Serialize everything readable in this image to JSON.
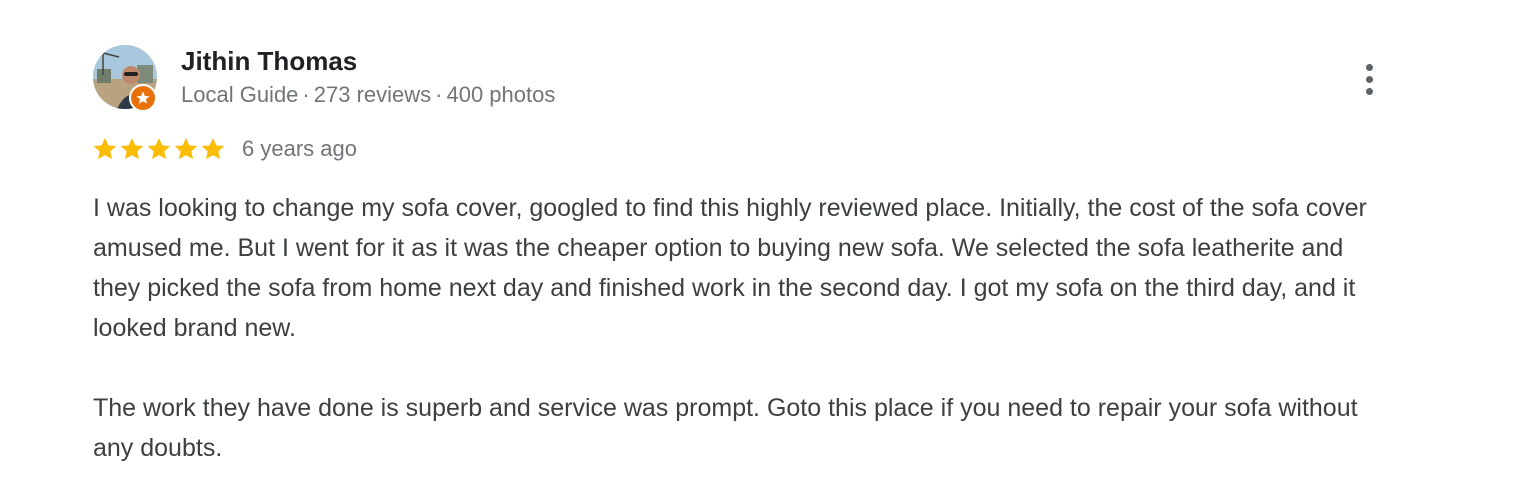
{
  "review": {
    "author": {
      "name": "Jithin Thomas",
      "role": "Local Guide",
      "reviews": "273 reviews",
      "photos": "400 photos",
      "separator": "·",
      "avatar": "profile-photo",
      "badge": "local-guide-star-badge"
    },
    "rating": 5,
    "rating_max": 5,
    "date": "6 years ago",
    "paragraphs": [
      "I was looking to change my sofa cover, googled to find this highly reviewed place. Initially, the cost of the sofa cover amused me. But I went for it as it was the cheaper option to buying new sofa. We selected the sofa leatherite and they picked the sofa from home next day and finished work in the second day. I got my sofa on the third day, and it looked brand new.",
      "The work they have done is superb and service was prompt. Goto this place if you need to repair your sofa without any doubts."
    ],
    "menu_icon": "more-vert-icon"
  },
  "colors": {
    "star": "#fbbc04",
    "badge": "#e8710a",
    "name": "#202124",
    "meta": "#70757a",
    "body": "#3c4043"
  }
}
